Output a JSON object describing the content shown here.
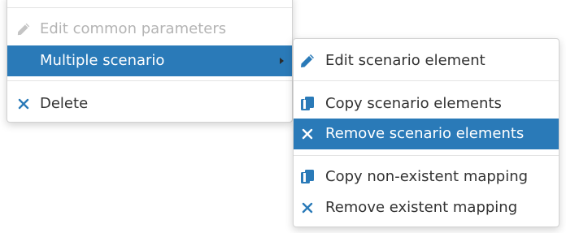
{
  "context_menu": {
    "items": [
      {
        "label": "Edit common parameters",
        "icon": "pencil-icon",
        "disabled": true
      },
      {
        "label": "Multiple scenario",
        "has_submenu": true,
        "highlighted": true
      },
      {
        "label": "Delete",
        "icon": "close-icon"
      }
    ]
  },
  "submenu": {
    "items": [
      {
        "label": "Edit scenario element",
        "icon": "pencil-icon"
      },
      {
        "label": "Copy scenario elements",
        "icon": "copy-icon"
      },
      {
        "label": "Remove scenario elements",
        "icon": "close-icon",
        "highlighted": true
      },
      {
        "label": "Copy non-existent mapping",
        "icon": "copy-icon"
      },
      {
        "label": "Remove existent mapping",
        "icon": "close-icon"
      }
    ]
  },
  "colors": {
    "highlight": "#2a7ab8",
    "icon": "#2a7ab8",
    "disabled_text": "#b4b4b4",
    "text": "#333333"
  }
}
